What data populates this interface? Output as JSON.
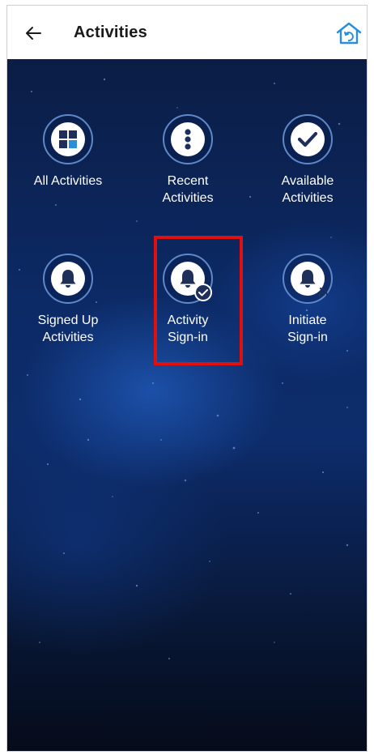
{
  "header": {
    "title": "Activities"
  },
  "activities": [
    {
      "line1": "All Activities",
      "line2": ""
    },
    {
      "line1": "Recent",
      "line2": "Activities"
    },
    {
      "line1": "Available",
      "line2": "Activities"
    },
    {
      "line1": "Signed Up",
      "line2": "Activities"
    },
    {
      "line1": "Activity",
      "line2": "Sign-in"
    },
    {
      "line1": "Initiate",
      "line2": "Sign-in"
    }
  ],
  "icons": {
    "back": "arrow-left-icon",
    "home": "home-refresh-icon",
    "activity_icons": [
      "grid-icon",
      "vertical-dots-icon",
      "checkmark-icon",
      "bell-icon",
      "bell-check-icon",
      "bell-signal-icon"
    ]
  },
  "colors": {
    "highlight": "#e01010",
    "accent": "#2a8fd8",
    "background_dark": "#0c2a66"
  }
}
